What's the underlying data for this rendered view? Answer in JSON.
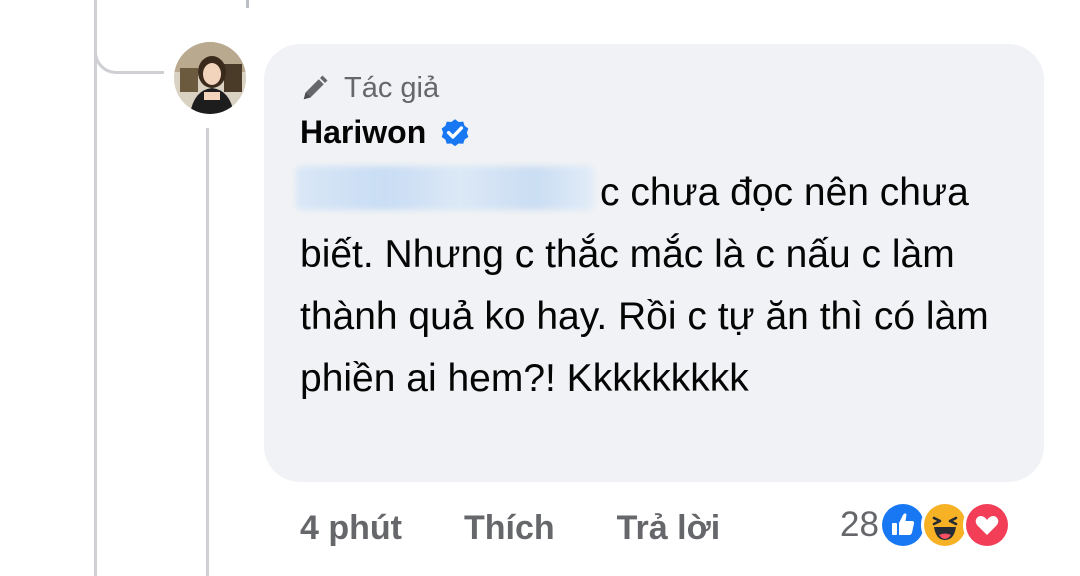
{
  "comment": {
    "author_badge": "Tác giả",
    "author_name": "Hariwon",
    "text": "c chưa đọc nên chưa biết. Nhưng c thắc mắc là c nấu c làm thành quả ko hay. Rồi c tự ăn thì có làm phiền ai hem?! Kkkkkkkkk",
    "time": "4 phút",
    "like_label": "Thích",
    "reply_label": "Trả lời",
    "reaction_count": "28",
    "reactions": [
      "like-icon",
      "haha-icon",
      "love-icon"
    ]
  },
  "colors": {
    "bubble_bg": "#f0f2f5",
    "secondary_text": "#65676b",
    "verified_blue": "#1877f2",
    "love_red": "#f33e58",
    "haha_yellow": "#f7b125"
  }
}
